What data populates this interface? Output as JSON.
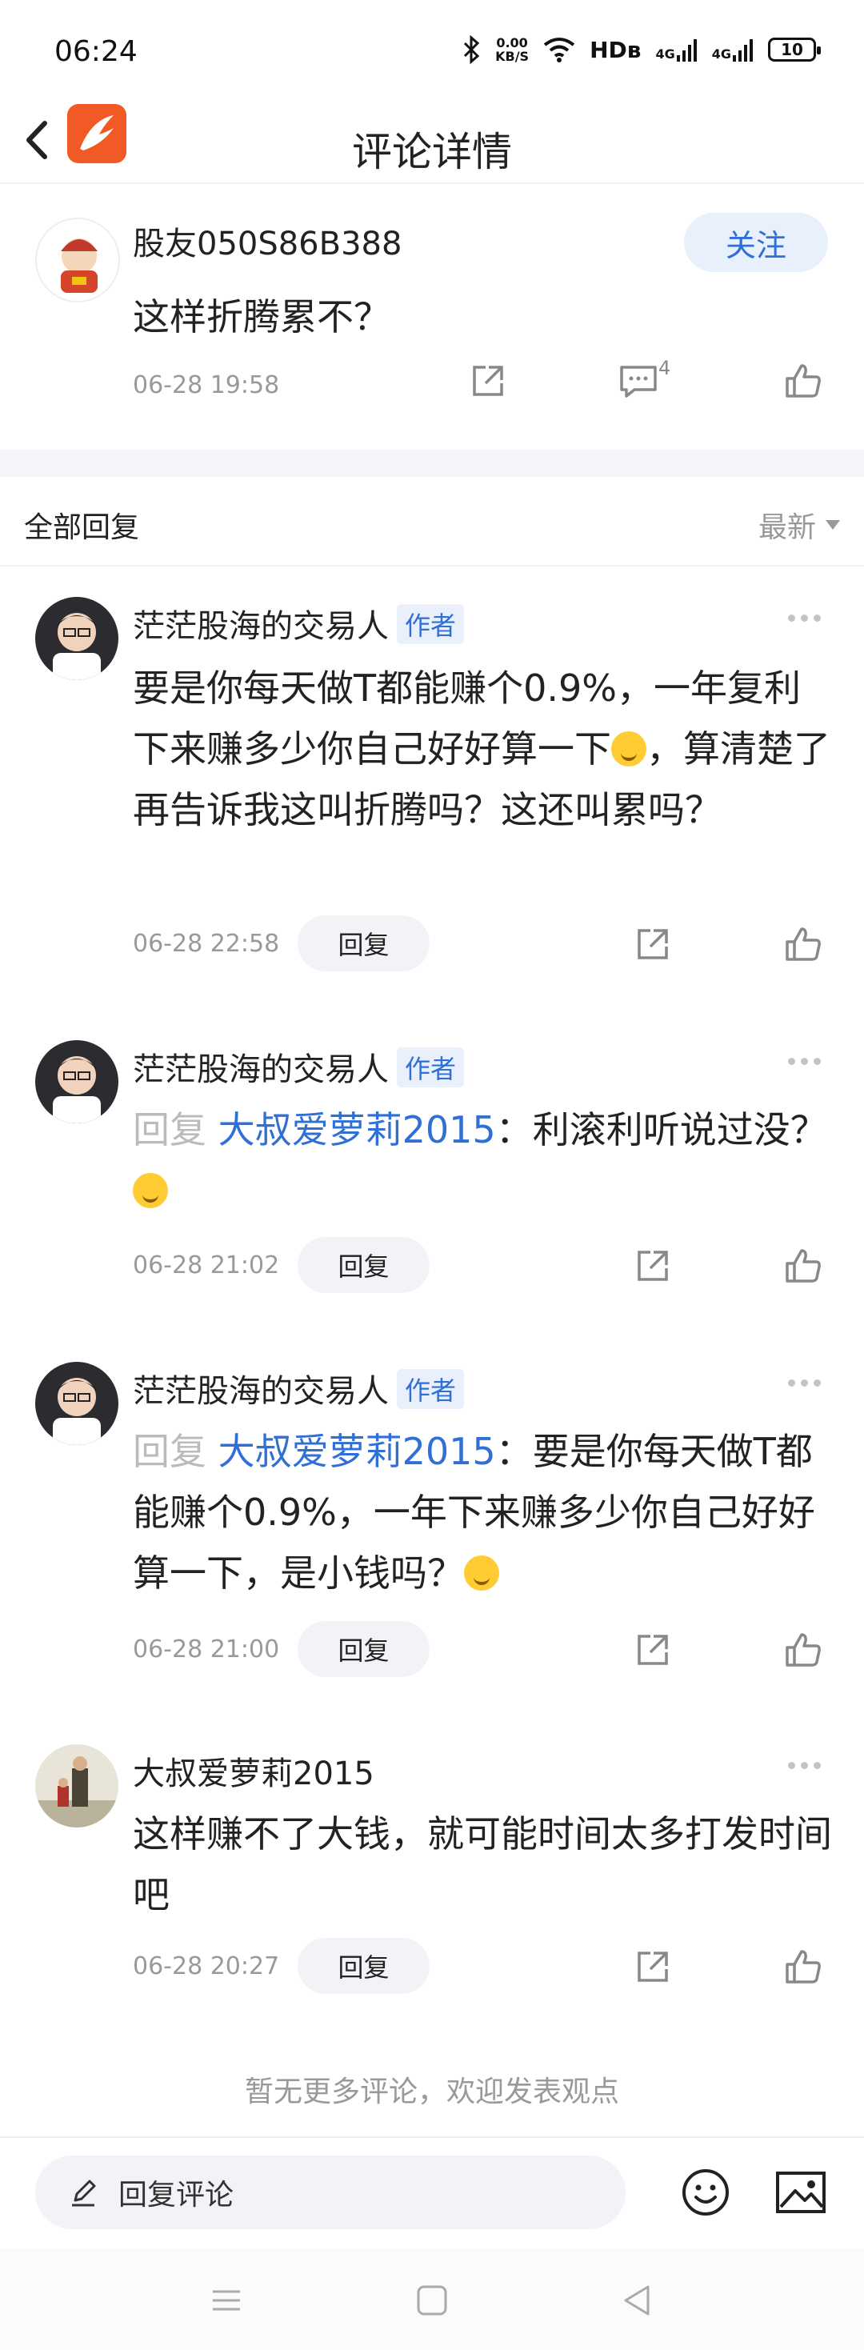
{
  "status_bar": {
    "time": "06:24",
    "net_speed_value": "0.00",
    "net_speed_unit": "KB/S",
    "hd_label": "HDв",
    "signal_1": "4G",
    "signal_2": "4G",
    "battery": "10"
  },
  "header": {
    "title": "评论详情",
    "back_icon": "chevron-left-icon",
    "logo": "app-logo"
  },
  "main_comment": {
    "user": "股友050S86B388",
    "follow_label": "关注",
    "text": "这样折腾累不？",
    "time": "06-28 19:58",
    "comment_count": "4"
  },
  "replies_header": {
    "title": "全部回复",
    "sort_label": "最新"
  },
  "replies": [
    {
      "user": "茫茫股海的交易人",
      "badge": "作者",
      "text": "要是你每天做T都能赚个0.9%，一年复利下来赚多少你自己好好算一下",
      "text_after_emoji": "，算清楚了再告诉我这叫折腾吗？这还叫累吗？",
      "time": "06-28 22:58",
      "reply_label": "回复"
    },
    {
      "user": "茫茫股海的交易人",
      "badge": "作者",
      "prefix": "回复 ",
      "reply_to": "大叔爱萝莉2015",
      "colon": "：",
      "text": "利滚利听说过没？",
      "time": "06-28 21:02",
      "reply_label": "回复"
    },
    {
      "user": "茫茫股海的交易人",
      "badge": "作者",
      "prefix": "回复 ",
      "reply_to": "大叔爱萝莉2015",
      "colon": "：",
      "text": "要是你每天做T都能赚个0.9%，一年下来赚多少你自己好好算一下，是小钱吗？",
      "time": "06-28 21:00",
      "reply_label": "回复"
    },
    {
      "user": "大叔爱萝莉2015",
      "text": "这样赚不了大钱，就可能时间太多打发时间吧",
      "time": "06-28 20:27",
      "reply_label": "回复"
    }
  ],
  "footer_note": "暂无更多评论，欢迎发表观点",
  "input_bar": {
    "placeholder": "回复评论"
  },
  "colors": {
    "accent": "#2f6fd6",
    "logo": "#f15a24",
    "muted": "#999999"
  }
}
